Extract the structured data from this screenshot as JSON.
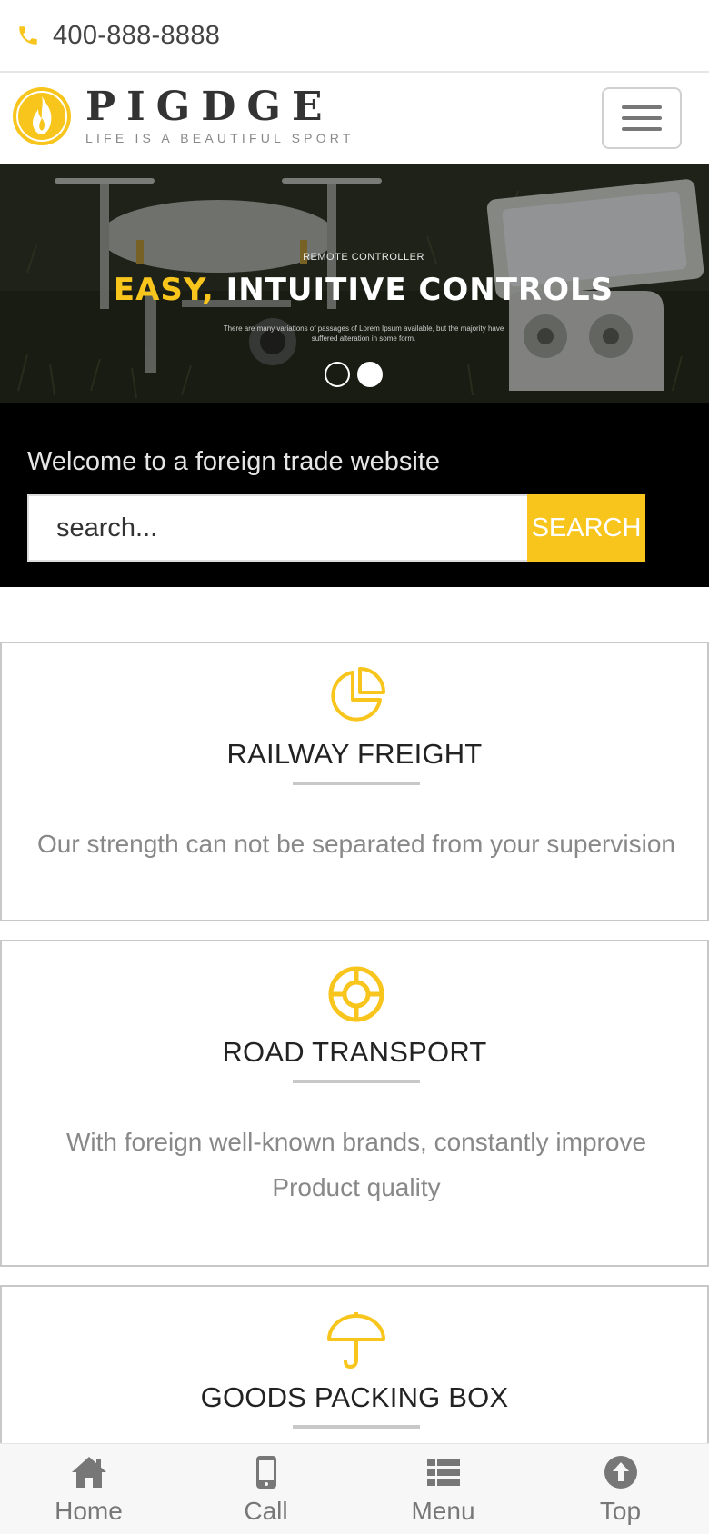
{
  "topbar": {
    "phone_icon": "phone-icon",
    "phone": "400-888-8888"
  },
  "header": {
    "logo_name": "PIGDGE",
    "logo_slogan": "LIFE IS A BEAUTIFUL SPORT",
    "menu_icon": "hamburger-icon"
  },
  "hero": {
    "kicker": "REMOTE CONTROLLER",
    "title_accent": "EASY,",
    "title_rest": "INTUITIVE CONTROLS",
    "description": "There are many variations of passages of Lorem Ipsum available, but the majority have suffered alteration in some form.",
    "slides": 2,
    "active_slide": 2
  },
  "search": {
    "welcome": "Welcome to a foreign trade website",
    "placeholder": "search...",
    "button": "SEARCH"
  },
  "cards": [
    {
      "icon": "pie-chart-icon",
      "title": "RAILWAY FREIGHT",
      "text": "Our strength can not be separated from your supervision"
    },
    {
      "icon": "lifebuoy-icon",
      "title": "ROAD TRANSPORT",
      "text": "With foreign well-known brands, constantly improve Product quality"
    },
    {
      "icon": "umbrella-icon",
      "title": "GOODS PACKING BOX",
      "text": ""
    }
  ],
  "bottom_nav": [
    {
      "icon": "home-icon",
      "label": "Home"
    },
    {
      "icon": "mobile-phone-icon",
      "label": "Call"
    },
    {
      "icon": "list-icon",
      "label": "Menu"
    },
    {
      "icon": "arrow-up-circle-icon",
      "label": "Top"
    }
  ],
  "colors": {
    "accent": "#f8c51c",
    "band": "#000000",
    "muted_text": "#888888"
  }
}
